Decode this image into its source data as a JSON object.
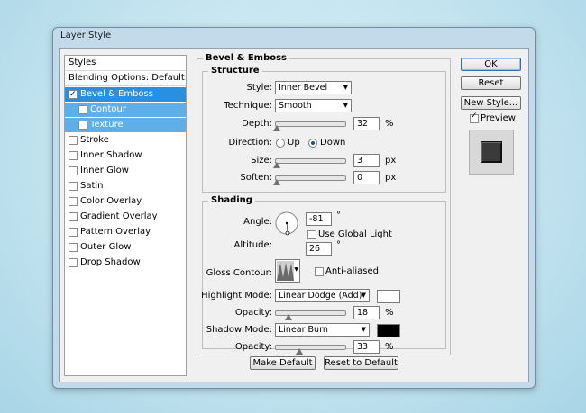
{
  "window": {
    "title": "Layer Style"
  },
  "styles_list": {
    "header": "Styles",
    "blending": "Blending Options: Default",
    "items": [
      {
        "label": "Bevel & Emboss",
        "checked": true
      },
      {
        "label": "Contour",
        "checked": false
      },
      {
        "label": "Texture",
        "checked": false
      },
      {
        "label": "Stroke",
        "checked": false
      },
      {
        "label": "Inner Shadow",
        "checked": false
      },
      {
        "label": "Inner Glow",
        "checked": false
      },
      {
        "label": "Satin",
        "checked": false
      },
      {
        "label": "Color Overlay",
        "checked": false
      },
      {
        "label": "Gradient Overlay",
        "checked": false
      },
      {
        "label": "Pattern Overlay",
        "checked": false
      },
      {
        "label": "Outer Glow",
        "checked": false
      },
      {
        "label": "Drop Shadow",
        "checked": false
      }
    ]
  },
  "panel": {
    "title": "Bevel & Emboss"
  },
  "structure": {
    "title": "Structure",
    "style_label": "Style:",
    "style_value": "Inner Bevel",
    "technique_label": "Technique:",
    "technique_value": "Smooth",
    "depth_label": "Depth:",
    "depth_value": "32",
    "depth_unit": "%",
    "depth_level": 0.0,
    "direction_label": "Direction:",
    "dir_up": "Up",
    "dir_down": "Down",
    "direction_selected": "Down",
    "size_label": "Size:",
    "size_value": "3",
    "size_unit": "px",
    "soften_label": "Soften:",
    "soften_value": "0",
    "soften_unit": "px"
  },
  "shading": {
    "title": "Shading",
    "angle_label": "Angle:",
    "angle_value": "-81",
    "angle_unit": "°",
    "global_light_label": "Use Global Light",
    "global_light_checked": false,
    "altitude_label": "Altitude:",
    "altitude_value": "26",
    "altitude_unit": "°",
    "gloss_label": "Gloss Contour:",
    "anti_aliased_label": "Anti-aliased",
    "anti_aliased_checked": false,
    "highlight_label": "Highlight Mode:",
    "highlight_value": "Linear Dodge (Add)",
    "highlight_color": "#ffffff",
    "h_opacity_label": "Opacity:",
    "h_opacity_value": "18",
    "h_opacity_unit": "%",
    "shadow_label": "Shadow Mode:",
    "shadow_value": "Linear Burn",
    "shadow_color": "#000000",
    "s_opacity_label": "Opacity:",
    "s_opacity_value": "33",
    "s_opacity_unit": "%"
  },
  "buttons": {
    "make_default": "Make Default",
    "reset_default": "Reset to Default",
    "ok": "OK",
    "reset": "Reset",
    "new_style": "New Style...",
    "preview": "Preview",
    "preview_checked": true
  }
}
